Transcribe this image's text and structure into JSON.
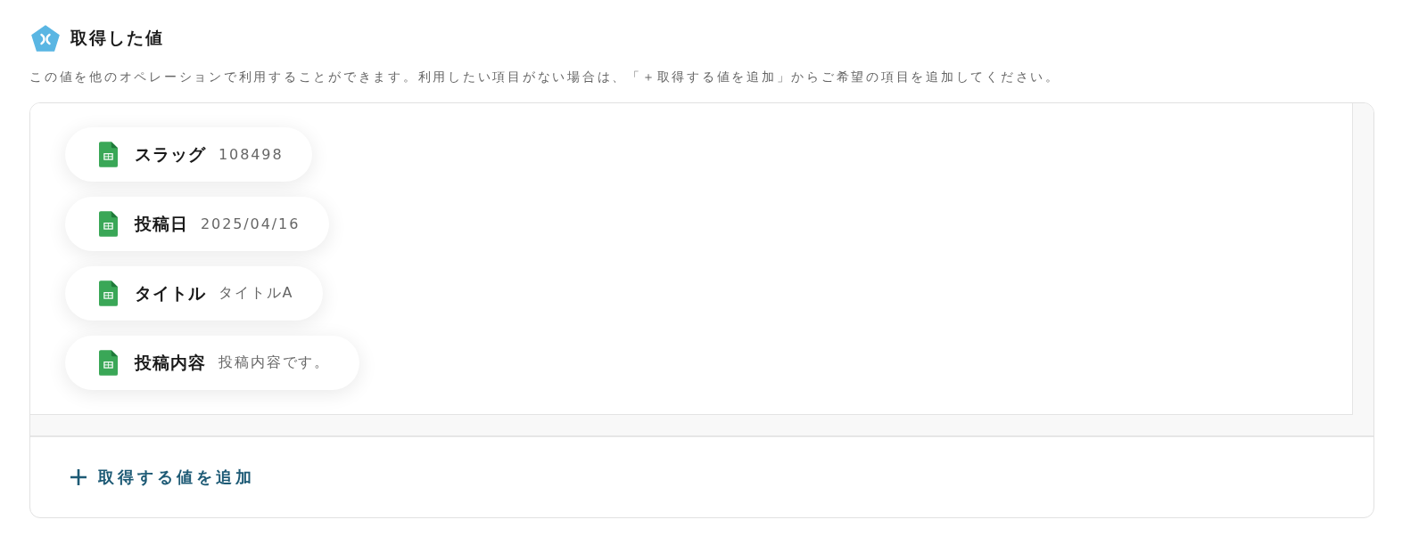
{
  "section": {
    "title": "取得した値",
    "description": "この値を他のオペレーションで利用することができます。利用したい項目がない場合は、「＋取得する値を追加」からご希望の項目を追加してください。"
  },
  "values": [
    {
      "label": "スラッグ",
      "value": "108498"
    },
    {
      "label": "投稿日",
      "value": "2025/04/16"
    },
    {
      "label": "タイトル",
      "value": "タイトルA"
    },
    {
      "label": "投稿内容",
      "value": "投稿内容です。"
    }
  ],
  "add_button": {
    "label": "取得する値を追加"
  }
}
